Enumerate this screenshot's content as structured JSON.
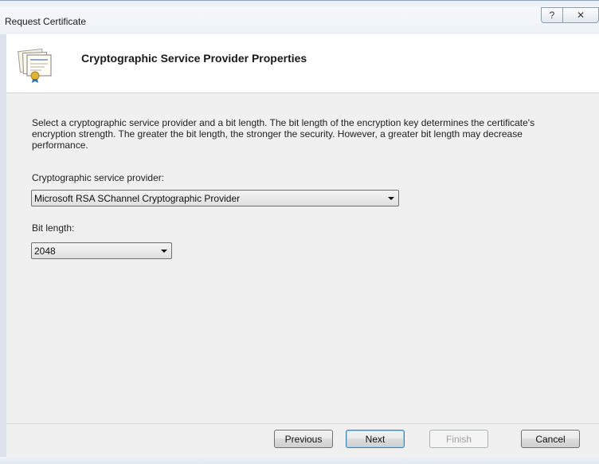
{
  "window": {
    "title": "Request Certificate",
    "help_button": "?",
    "close_button": "✕"
  },
  "header": {
    "title": "Cryptographic Service Provider Properties",
    "icon": "certificate-icon"
  },
  "content": {
    "description": "Select a cryptographic service provider and a bit length. The bit length of the encryption key determines the certificate's encryption strength. The greater the bit length, the stronger the security. However, a greater bit length may decrease performance.",
    "csp_label": "Cryptographic service provider:",
    "csp_value": "Microsoft RSA SChannel Cryptographic Provider",
    "bit_length_label": "Bit length:",
    "bit_length_value": "2048"
  },
  "buttons": {
    "previous": "Previous",
    "next": "Next",
    "finish": "Finish",
    "cancel": "Cancel"
  },
  "colors": {
    "dialog_bg": "#f0f0f0",
    "header_bg": "#ffffff",
    "default_button_border": "#3c7fb1"
  }
}
